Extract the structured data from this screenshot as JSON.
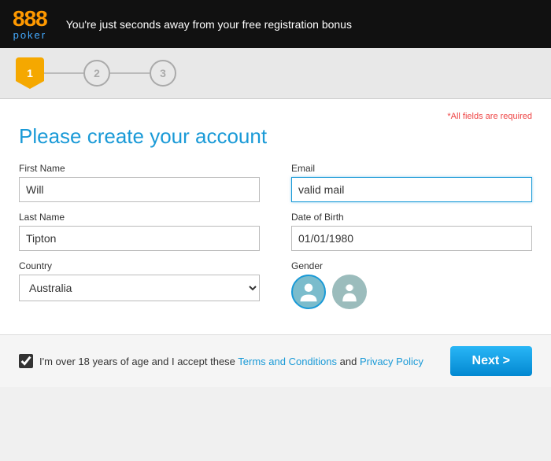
{
  "header": {
    "logo_top": "888",
    "logo_highlight": "8",
    "logo_bottom": "poker",
    "tagline": "You're just seconds away from your free registration bonus"
  },
  "steps": [
    {
      "number": "1",
      "active": true
    },
    {
      "number": "2",
      "active": false
    },
    {
      "number": "3",
      "active": false
    }
  ],
  "required_note": "*All fields are required",
  "page_title": "Please create your account",
  "form": {
    "first_name_label": "First Name",
    "first_name_value": "Will",
    "last_name_label": "Last Name",
    "last_name_value": "Tipton",
    "country_label": "Country",
    "country_value": "Australia",
    "email_label": "Email",
    "email_value": "valid mail",
    "dob_label": "Date of Birth",
    "dob_value": "01/01/1980",
    "gender_label": "Gender"
  },
  "terms": {
    "prefix": "I'm over 18 years of age and I accept these ",
    "terms_link": "Terms and Conditions",
    "conjunction": " and ",
    "privacy_link": "Privacy Policy"
  },
  "next_button": "Next >"
}
